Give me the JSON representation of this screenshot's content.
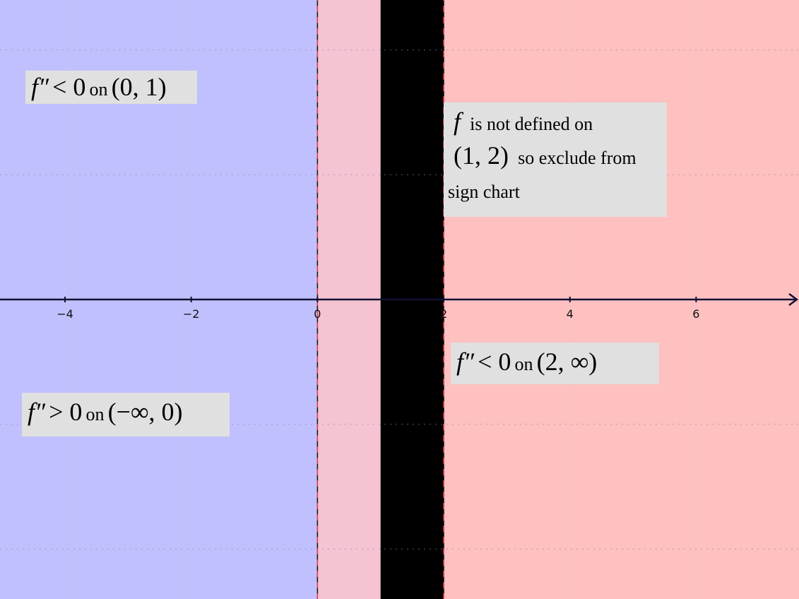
{
  "chart_data": {
    "type": "diagram",
    "xlim": [
      -5.03,
      7.63
    ],
    "ylim": [
      -2.4,
      2.4
    ],
    "grid": true,
    "x_ticks": [
      -4,
      -2,
      0,
      2,
      4,
      6
    ],
    "tick_labels": [
      "−4",
      "−2",
      "0",
      "2",
      "4",
      "6"
    ],
    "regions": [
      {
        "from": -5.03,
        "to": 0,
        "color": "#c0c0ff",
        "sign": "f'' > 0"
      },
      {
        "from": 0,
        "to": 1,
        "color": "#f5c3d2",
        "sign": "f'' < 0"
      },
      {
        "from": 1,
        "to": 2,
        "color": "#000000",
        "sign": "undefined"
      },
      {
        "from": 2,
        "to": 7.63,
        "color": "#ffc0c0",
        "sign": "f'' < 0"
      }
    ],
    "boundaries": [
      0,
      2
    ]
  },
  "labels": {
    "interval_01": {
      "fpp": "f″",
      "rel": "< 0",
      "on": "on",
      "interval": "(0, 1)"
    },
    "undefined_note": {
      "f": "f",
      "line1": "is not defined on",
      "interval": "(1, 2)",
      "line2": "so exclude from",
      "line3": "sign chart"
    },
    "interval_2inf": {
      "fpp": "f″",
      "rel": "< 0",
      "on": "on",
      "interval": "(2, ∞)"
    },
    "interval_neg_inf0": {
      "fpp": "f″",
      "rel": "> 0",
      "on": "on",
      "interval": "(−∞, 0)"
    }
  }
}
